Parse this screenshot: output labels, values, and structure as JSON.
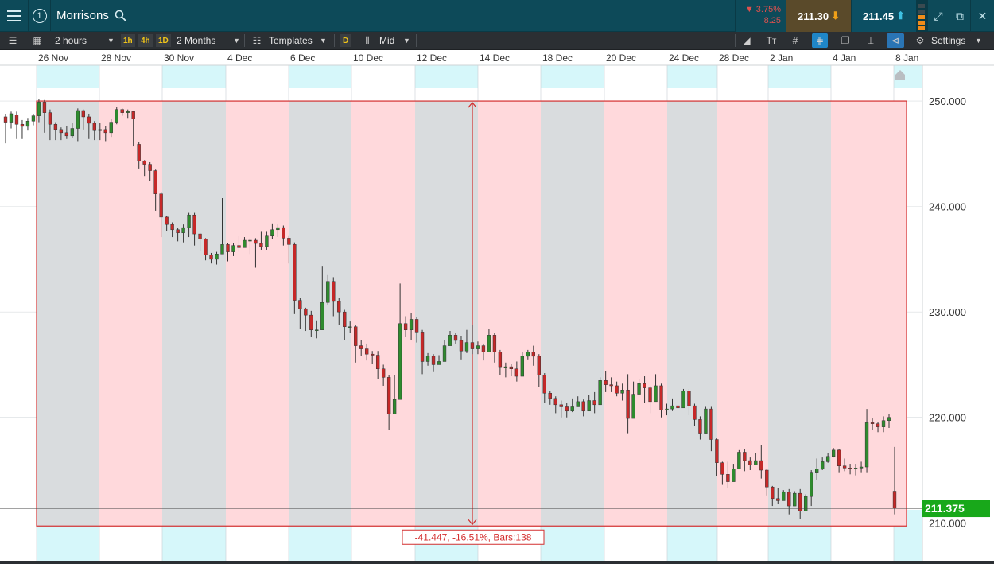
{
  "header": {
    "instrument": "Morrisons",
    "change_pct": "▼ 3.75%",
    "change_abs": "8.25",
    "sell_price": "211.30",
    "buy_price": "211.45"
  },
  "toolbar": {
    "interval": "2 hours",
    "tf_1h": "1h",
    "tf_4h": "4h",
    "tf_1d": "1D",
    "range": "2 Months",
    "templates": "Templates",
    "d_chip": "D",
    "price_type": "Mid",
    "settings": "Settings"
  },
  "colors": {
    "up_candle": "#2e8b2e",
    "down_candle": "#c62828",
    "measure_fill": "#ffd9dc",
    "measure_border": "#d32f2f",
    "weekend_shade": "#d9dcde",
    "current_price_bg": "#18a81a"
  },
  "chart_data": {
    "type": "candlestick",
    "title": "",
    "x_tick_labels": [
      "26 Nov",
      "28 Nov",
      "30 Nov",
      "4 Dec",
      "6 Dec",
      "10 Dec",
      "12 Dec",
      "14 Dec",
      "18 Dec",
      "20 Dec",
      "24 Dec",
      "28 Dec",
      "2 Jan",
      "4 Jan",
      "8 Jan"
    ],
    "y_ticks": [
      210.0,
      220.0,
      230.0,
      240.0,
      250.0
    ],
    "y_tick_labels": [
      "210.000",
      "220.000",
      "230.000",
      "240.000",
      "250.000"
    ],
    "ylim": [
      206.4,
      253.4
    ],
    "current_price": 211.375,
    "current_price_label": "211.375",
    "measurement": {
      "label": "-41.447, -16.51%, Bars:138",
      "top_price": 250.0,
      "bottom_price": 209.7
    },
    "candles": [
      [
        248.5,
        248.0,
        246.2,
        248.8,
        246.0
      ],
      [
        248.0,
        248.8,
        247.5,
        249.0,
        247.4
      ],
      [
        248.7,
        247.8,
        246.5,
        249.0,
        246.4
      ],
      [
        247.8,
        247.6,
        246.6,
        248.2,
        246.4
      ],
      [
        247.6,
        248.1,
        247.3,
        248.4,
        247.2
      ],
      [
        248.1,
        248.6,
        247.8,
        248.8,
        247.7
      ],
      [
        248.6,
        249.9,
        248.1,
        250.2,
        248.0
      ],
      [
        249.9,
        248.9,
        247.2,
        250.1,
        247.0
      ],
      [
        248.9,
        247.8,
        246.5,
        249.2,
        246.3
      ],
      [
        247.8,
        247.3,
        246.4,
        248.0,
        246.3
      ],
      [
        247.3,
        247.0,
        246.5,
        247.5,
        246.3
      ],
      [
        247.0,
        246.7,
        246.5,
        247.6,
        246.4
      ],
      [
        246.7,
        247.4,
        247.3,
        247.9,
        246.5
      ],
      [
        247.4,
        249.1,
        246.8,
        249.3,
        246.2
      ],
      [
        249.1,
        248.5,
        247.4,
        249.2,
        247.3
      ],
      [
        248.5,
        247.9,
        246.6,
        248.8,
        246.4
      ],
      [
        247.9,
        247.2,
        246.5,
        248.1,
        246.3
      ],
      [
        247.2,
        247.3,
        246.6,
        247.9,
        246.3
      ],
      [
        247.3,
        247.0,
        246.3,
        247.6,
        246.2
      ],
      [
        247.0,
        248.0,
        246.7,
        248.3,
        246.6
      ],
      [
        248.0,
        249.2,
        247.9,
        249.4,
        247.8
      ],
      [
        249.2,
        248.9,
        248.7,
        249.3,
        248.6
      ],
      [
        248.9,
        249.0,
        248.5,
        249.2,
        248.4
      ],
      [
        249.0,
        248.3,
        245.9,
        249.1,
        245.7
      ],
      [
        245.9,
        244.3,
        243.8,
        246.1,
        243.6
      ],
      [
        244.3,
        244.0,
        243.0,
        244.4,
        242.9
      ],
      [
        244.0,
        243.4,
        242.5,
        244.2,
        242.4
      ],
      [
        243.4,
        241.2,
        239.8,
        243.5,
        239.6
      ],
      [
        241.2,
        239.0,
        237.3,
        241.4,
        237.1
      ],
      [
        239.0,
        238.3,
        238.1,
        239.1,
        237.7
      ],
      [
        238.3,
        237.8,
        237.3,
        238.5,
        237.1
      ],
      [
        237.8,
        237.5,
        236.9,
        238.0,
        236.7
      ],
      [
        237.5,
        238.0,
        236.8,
        238.3,
        236.6
      ],
      [
        238.0,
        239.2,
        237.3,
        239.4,
        237.1
      ],
      [
        239.2,
        237.4,
        236.5,
        239.4,
        236.3
      ],
      [
        237.4,
        236.9,
        235.9,
        237.5,
        235.8
      ],
      [
        236.9,
        235.4,
        235.0,
        237.0,
        234.9
      ],
      [
        235.4,
        235.0,
        234.7,
        235.6,
        234.6
      ],
      [
        235.0,
        235.5,
        234.7,
        235.7,
        234.5
      ],
      [
        235.5,
        236.4,
        236.1,
        240.8,
        235.6
      ],
      [
        236.4,
        235.7,
        234.9,
        236.5,
        234.8
      ],
      [
        235.7,
        236.3,
        235.4,
        236.5,
        235.3
      ],
      [
        236.3,
        236.1,
        235.8,
        237.2,
        235.7
      ],
      [
        236.1,
        236.8,
        236.3,
        237.1,
        236.2
      ],
      [
        236.8,
        236.8,
        235.6,
        237.0,
        235.5
      ],
      [
        236.8,
        236.5,
        234.4,
        237.0,
        234.2
      ],
      [
        236.5,
        236.2,
        236.0,
        237.6,
        235.9
      ],
      [
        236.2,
        237.2,
        236.0,
        237.6,
        235.9
      ],
      [
        237.2,
        237.8,
        237.0,
        238.4,
        236.9
      ],
      [
        237.8,
        238.0,
        237.2,
        238.3,
        237.1
      ],
      [
        238.0,
        237.0,
        236.5,
        238.2,
        236.3
      ],
      [
        237.0,
        236.4,
        234.7,
        237.2,
        234.6
      ],
      [
        236.4,
        231.1,
        230.0,
        236.6,
        229.8
      ],
      [
        231.1,
        230.3,
        228.7,
        231.3,
        228.4
      ],
      [
        230.3,
        229.7,
        228.4,
        230.4,
        228.2
      ],
      [
        229.7,
        228.3,
        227.8,
        230.1,
        227.6
      ],
      [
        228.3,
        228.3,
        227.9,
        229.2,
        227.5
      ],
      [
        228.3,
        230.9,
        230.6,
        234.3,
        230.2
      ],
      [
        230.9,
        232.9,
        230.9,
        233.5,
        230.7
      ],
      [
        232.9,
        231.0,
        229.8,
        233.3,
        229.6
      ],
      [
        231.0,
        230.0,
        229.0,
        231.3,
        228.8
      ],
      [
        230.0,
        228.6,
        227.5,
        230.2,
        227.3
      ],
      [
        228.6,
        228.6,
        228.2,
        229.1,
        228.0
      ],
      [
        228.6,
        226.8,
        225.8,
        228.8,
        225.2
      ],
      [
        226.8,
        226.5,
        226.0,
        227.3,
        225.8
      ],
      [
        226.5,
        226.0,
        225.6,
        227.0,
        225.4
      ],
      [
        226.0,
        225.9,
        225.3,
        226.3,
        225.1
      ],
      [
        225.9,
        224.6,
        223.8,
        226.3,
        223.6
      ],
      [
        224.6,
        223.8,
        223.2,
        225.0,
        223.0
      ],
      [
        223.8,
        220.3,
        219.3,
        224.0,
        218.8
      ],
      [
        220.3,
        221.7,
        221.3,
        224.0,
        221.0
      ],
      [
        221.7,
        228.9,
        228.1,
        232.7,
        227.8
      ],
      [
        228.9,
        228.3,
        228.1,
        229.6,
        227.6
      ],
      [
        228.3,
        229.3,
        227.5,
        229.9,
        227.3
      ],
      [
        229.3,
        228.1,
        227.3,
        229.5,
        227.1
      ],
      [
        228.1,
        225.3,
        224.3,
        228.3,
        224.1
      ],
      [
        225.3,
        225.8,
        225.1,
        226.1,
        224.9
      ],
      [
        225.8,
        225.0,
        224.5,
        226.0,
        224.3
      ],
      [
        225.0,
        225.3,
        225.2,
        225.9,
        225.0
      ],
      [
        225.3,
        226.8,
        226.5,
        227.3,
        226.3
      ],
      [
        226.8,
        227.8,
        227.5,
        228.2,
        227.3
      ],
      [
        227.8,
        227.3,
        227.2,
        228.0,
        227.0
      ],
      [
        227.3,
        226.3,
        225.6,
        227.7,
        225.5
      ],
      [
        226.3,
        227.1,
        226.2,
        228.3,
        226.1
      ],
      [
        227.1,
        226.5,
        226.1,
        228.8,
        226.0
      ],
      [
        226.5,
        226.8,
        226.3,
        227.2,
        226.0
      ],
      [
        226.8,
        226.2,
        225.5,
        227.0,
        225.4
      ],
      [
        226.2,
        227.8,
        227.1,
        228.4,
        227.0
      ],
      [
        227.8,
        226.2,
        225.4,
        228.0,
        225.2
      ],
      [
        226.2,
        224.8,
        224.2,
        226.4,
        224.0
      ],
      [
        224.8,
        224.8,
        224.0,
        225.2,
        223.8
      ],
      [
        224.8,
        224.6,
        224.0,
        225.1,
        223.9
      ],
      [
        224.6,
        223.9,
        223.6,
        225.3,
        223.4
      ],
      [
        223.9,
        225.8,
        224.3,
        226.2,
        224.0
      ],
      [
        225.8,
        226.2,
        225.8,
        226.4,
        225.5
      ],
      [
        226.2,
        225.8,
        225.0,
        226.8,
        224.9
      ],
      [
        225.8,
        224.0,
        223.1,
        226.0,
        222.9
      ],
      [
        224.0,
        222.3,
        221.6,
        224.2,
        221.4
      ],
      [
        222.3,
        221.8,
        221.5,
        222.5,
        221.2
      ],
      [
        221.8,
        221.2,
        220.7,
        222.0,
        220.4
      ],
      [
        221.2,
        221.0,
        220.6,
        221.6,
        220.0
      ],
      [
        221.0,
        220.6,
        220.2,
        221.4,
        220.0
      ],
      [
        220.6,
        221.0,
        220.6,
        221.8,
        220.5
      ],
      [
        221.0,
        221.5,
        221.4,
        222.0,
        221.2
      ],
      [
        221.5,
        220.6,
        220.3,
        221.7,
        220.1
      ],
      [
        220.6,
        221.6,
        221.5,
        222.1,
        221.4
      ],
      [
        221.6,
        221.2,
        220.6,
        222.4,
        220.4
      ],
      [
        221.2,
        223.5,
        223.2,
        223.8,
        223.0
      ],
      [
        223.5,
        223.1,
        222.6,
        224.4,
        222.4
      ],
      [
        223.1,
        223.0,
        222.6,
        223.8,
        222.4
      ],
      [
        223.0,
        222.3,
        222.2,
        223.4,
        222.0
      ],
      [
        222.3,
        222.6,
        221.8,
        223.2,
        221.6
      ],
      [
        222.6,
        219.9,
        219.0,
        224.1,
        218.5
      ],
      [
        219.9,
        222.2,
        221.9,
        223.4,
        221.6
      ],
      [
        222.2,
        223.2,
        222.8,
        223.6,
        222.6
      ],
      [
        223.2,
        222.8,
        221.5,
        223.9,
        221.4
      ],
      [
        222.8,
        221.5,
        220.6,
        223.0,
        220.4
      ],
      [
        221.5,
        223.0,
        222.8,
        224.1,
        222.6
      ],
      [
        223.0,
        220.7,
        220.2,
        223.2,
        220.0
      ],
      [
        220.7,
        220.8,
        220.4,
        221.3,
        220.2
      ],
      [
        220.8,
        221.1,
        220.8,
        221.8,
        220.6
      ],
      [
        221.1,
        220.9,
        220.5,
        221.4,
        220.3
      ],
      [
        220.9,
        222.5,
        221.2,
        222.7,
        221.0
      ],
      [
        222.5,
        221.1,
        220.4,
        222.7,
        220.2
      ],
      [
        221.1,
        219.8,
        219.4,
        221.3,
        219.2
      ],
      [
        219.8,
        218.5,
        218.1,
        220.1,
        217.9
      ],
      [
        218.5,
        220.8,
        218.9,
        221.0,
        218.7
      ],
      [
        220.8,
        217.9,
        217.2,
        221.0,
        216.8
      ],
      [
        217.9,
        215.7,
        214.7,
        218.0,
        214.4
      ],
      [
        215.7,
        214.6,
        213.8,
        215.8,
        213.6
      ],
      [
        214.6,
        213.9,
        213.4,
        215.8,
        213.3
      ],
      [
        213.9,
        215.1,
        214.3,
        215.6,
        214.1
      ],
      [
        215.1,
        216.7,
        216.1,
        216.9,
        215.9
      ],
      [
        216.7,
        215.9,
        215.1,
        217.0,
        214.9
      ],
      [
        215.9,
        215.5,
        215.2,
        216.2,
        215.0
      ],
      [
        215.5,
        215.9,
        215.7,
        216.6,
        215.6
      ],
      [
        215.9,
        215.0,
        214.3,
        217.4,
        214.2
      ],
      [
        215.0,
        213.4,
        212.7,
        215.1,
        212.6
      ],
      [
        213.4,
        212.3,
        211.8,
        213.5,
        211.6
      ],
      [
        212.3,
        212.1,
        212.0,
        213.3,
        211.8
      ],
      [
        212.1,
        212.9,
        212.6,
        213.1,
        212.4
      ],
      [
        212.9,
        211.6,
        211.1,
        213.2,
        210.8
      ],
      [
        211.6,
        212.8,
        211.9,
        213.0,
        211.6
      ],
      [
        212.8,
        211.1,
        210.7,
        213.2,
        210.4
      ],
      [
        211.1,
        212.5,
        211.3,
        212.7,
        211.1
      ],
      [
        212.5,
        214.8,
        211.8,
        215.0,
        211.6
      ],
      [
        214.8,
        215.1,
        214.3,
        216.1,
        214.1
      ],
      [
        215.1,
        215.8,
        215.2,
        216.2,
        215.0
      ],
      [
        215.8,
        216.3,
        215.9,
        216.6,
        215.7
      ],
      [
        216.3,
        216.9,
        216.5,
        217.1,
        216.2
      ],
      [
        216.9,
        215.4,
        214.9,
        217.0,
        214.8
      ],
      [
        215.4,
        215.2,
        215.0,
        216.1,
        214.9
      ],
      [
        215.2,
        215.1,
        214.8,
        215.6,
        214.6
      ],
      [
        215.1,
        215.2,
        214.7,
        215.6,
        214.5
      ],
      [
        215.2,
        215.3,
        215.0,
        215.8,
        214.8
      ],
      [
        215.3,
        219.5,
        215.0,
        220.8,
        214.8
      ],
      [
        219.5,
        219.4,
        219.0,
        219.9,
        218.8
      ],
      [
        219.4,
        219.1,
        218.8,
        219.6,
        218.6
      ],
      [
        219.1,
        219.7,
        218.8,
        220.1,
        218.6
      ],
      [
        219.7,
        220.0,
        219.1,
        220.3,
        219.0
      ],
      [
        213.0,
        211.375,
        211.0,
        217.2,
        210.8
      ]
    ]
  }
}
